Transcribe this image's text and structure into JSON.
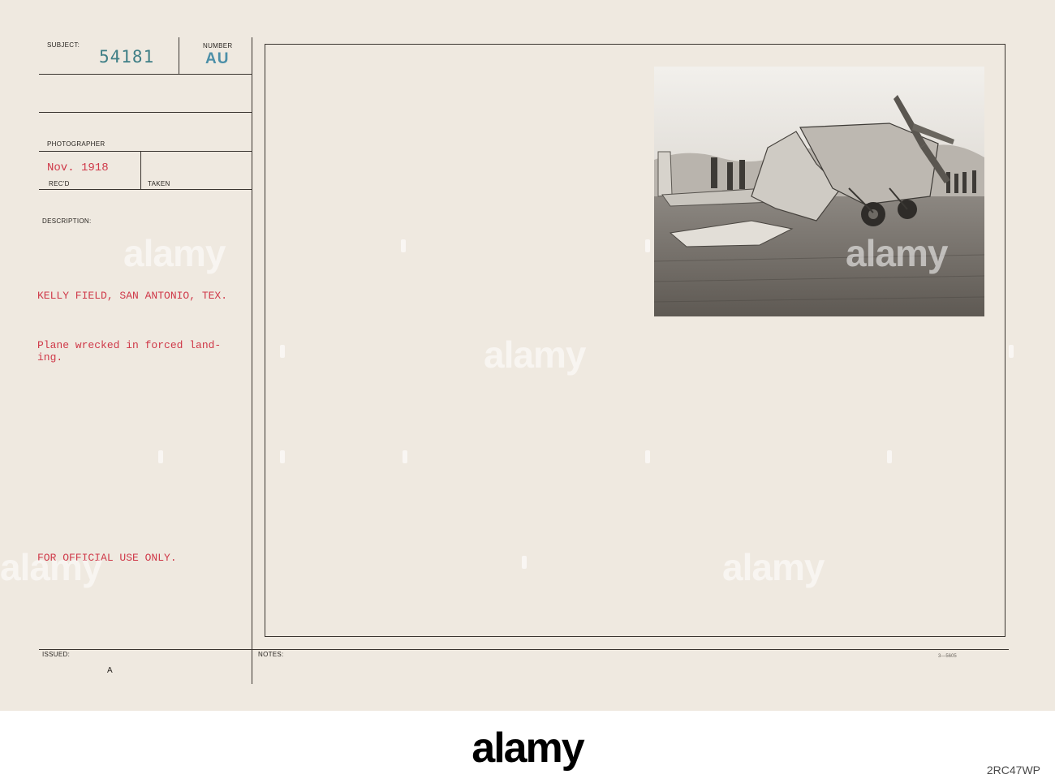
{
  "card": {
    "subject_label": "SUBJECT:",
    "subject_number": "54181",
    "number_label": "NUMBER",
    "number_code": "AU",
    "photographer_label": "PHOTOGRAPHER",
    "date_value": "Nov.  1918",
    "recd_label": "REC'D",
    "taken_label": "TAKEN",
    "description_label": "DESCRIPTION:",
    "location_line": "KELLY FIELD, SAN ANTONIO, TEX.",
    "caption_line1": "Plane wrecked in forced land-",
    "caption_line2": "ing.",
    "official_use": "FOR OFFICIAL USE ONLY.",
    "issued_label": "ISSUED:",
    "issued_mark": "A",
    "notes_label": "NOTES:",
    "form_number": "3—5605"
  },
  "watermark": {
    "text": "alamy"
  },
  "footer": {
    "logo": "alamy",
    "image_id": "2RC47WP"
  },
  "colors": {
    "paper": "#efe9e0",
    "typed_red": "#cf3848",
    "stamp_teal": "#3f7f86"
  }
}
